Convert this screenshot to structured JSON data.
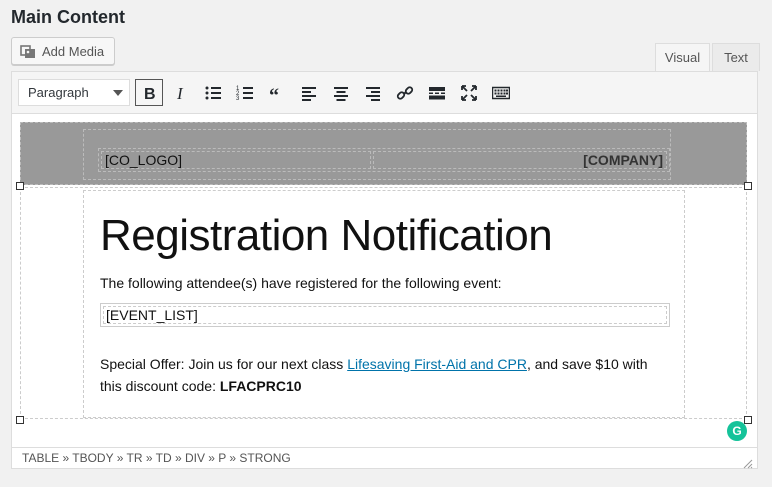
{
  "page": {
    "title": "Main Content"
  },
  "add_media": {
    "label": "Add Media",
    "icon": "media-icon"
  },
  "tabs": [
    {
      "label": "Visual",
      "active": true
    },
    {
      "label": "Text",
      "active": false
    }
  ],
  "toolbar": {
    "format_value": "Paragraph",
    "buttons": [
      {
        "name": "bold-button",
        "icon": "bold-icon",
        "active": true
      },
      {
        "name": "italic-button",
        "icon": "italic-icon",
        "active": false
      },
      {
        "name": "bulleted-list-button",
        "icon": "bulleted-list-icon",
        "active": false
      },
      {
        "name": "numbered-list-button",
        "icon": "numbered-list-icon",
        "active": false
      },
      {
        "name": "blockquote-button",
        "icon": "blockquote-icon",
        "active": false
      },
      {
        "name": "align-left-button",
        "icon": "align-left-icon",
        "active": false
      },
      {
        "name": "align-center-button",
        "icon": "align-center-icon",
        "active": false
      },
      {
        "name": "align-right-button",
        "icon": "align-right-icon",
        "active": false
      },
      {
        "name": "insert-link-button",
        "icon": "link-icon",
        "active": false
      },
      {
        "name": "read-more-button",
        "icon": "read-more-icon",
        "active": false
      },
      {
        "name": "fullscreen-button",
        "icon": "fullscreen-icon",
        "active": false
      },
      {
        "name": "toolbar-toggle-button",
        "icon": "keyboard-icon",
        "active": false
      }
    ]
  },
  "content": {
    "logo_placeholder": "[CO_LOGO]",
    "company_placeholder": "[COMPANY]",
    "headline": "Registration Notification",
    "intro": "The following attendee(s) have registered for the following event:",
    "event_list": "[EVENT_LIST]",
    "offer_prefix": "Special Offer: Join us for our next class ",
    "offer_link": "Lifesaving First-Aid and CPR",
    "offer_suffix": ", and save $10 with this discount code: ",
    "discount_code": "LFACPRC10"
  },
  "statusbar": {
    "path": "TABLE » TBODY » TR » TD » DIV » P » STRONG"
  },
  "colors": {
    "link": "#0073aa",
    "header_band": "#999999",
    "grammarly": "#15c39a"
  }
}
